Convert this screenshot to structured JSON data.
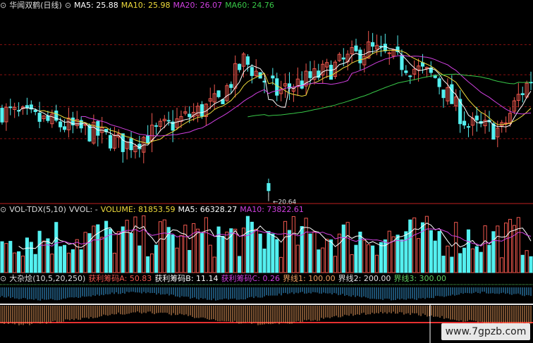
{
  "colors": {
    "up": "#f0584e",
    "down": "#54f0f0",
    "ma5": "#ffffff",
    "ma10": "#f0dc3c",
    "ma20": "#d040e0",
    "ma60": "#38c848",
    "grid": "#8a1010",
    "vol_ma5": "#ffffff",
    "vol_ma10": "#d040e0",
    "zone_line": "#e63030",
    "orange": "#f0a060",
    "green": "#60d060"
  },
  "price_panel": {
    "icon": "settings-icon",
    "title": "华闻双鹤(日线)",
    "ma5_label": "MA5: 25.88",
    "ma10_label": "MA10: 25.98",
    "ma20_label": "MA20: 26.07",
    "ma60_label": "MA60: 24.76",
    "low_marker": "20.64"
  },
  "volume_panel": {
    "indicator": "VOL-TDX(5,10)",
    "vvol": "VVOL: -",
    "volume": "VOLUME: 81853.59",
    "ma5": "MA5: 66328.27",
    "ma10": "MA10: 73822.61"
  },
  "bottom_panel": {
    "icon": "settings-icon",
    "indicator": "大杂烩(10,5,20,250)",
    "a_label": "获利筹码A: 50.83",
    "b_label": "获利筹码B: 11.14",
    "c_label": "获利筹码C: 0.26",
    "j1_label": "界线1: 100.00",
    "j2_label": "界线2: 200.00",
    "j3_label": "界线3: 300.00"
  },
  "watermark": "www.7gpzb.com",
  "chart_data": {
    "type": "candlestick",
    "y_range": [
      20.6,
      28.0
    ],
    "annotated_low": 20.64,
    "candles_count": 128,
    "ma_series": [
      {
        "name": "MA5",
        "last": 25.88
      },
      {
        "name": "MA10",
        "last": 25.98
      },
      {
        "name": "MA20",
        "last": 26.07
      },
      {
        "name": "MA60",
        "last": 24.76
      }
    ],
    "volume": {
      "last": 81853.59,
      "ma5": 66328.27,
      "ma10": 73822.61
    },
    "profit_chips": {
      "A": 50.83,
      "B": 11.14,
      "C": 0.26
    },
    "boundaries": [
      100.0,
      200.0,
      300.0
    ]
  }
}
